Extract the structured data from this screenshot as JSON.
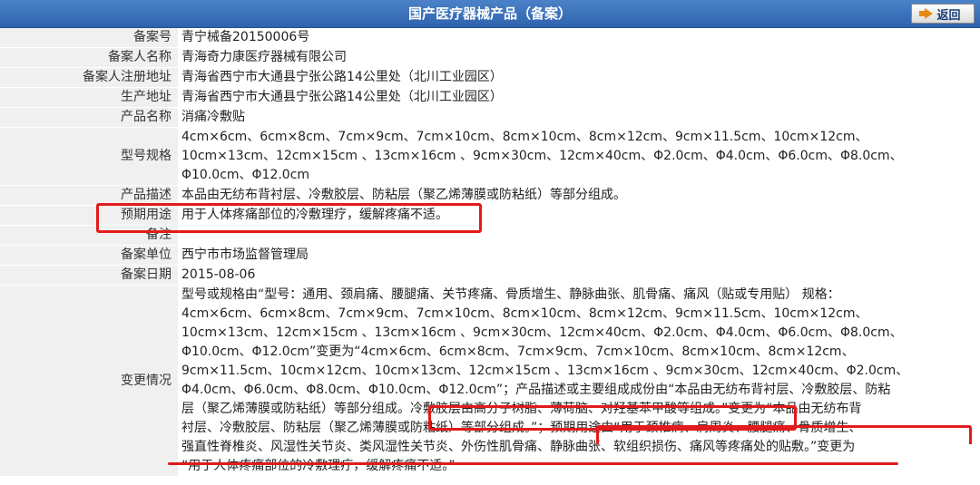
{
  "header": {
    "title": "国产医疗器械产品（备案）",
    "back_label": "返回"
  },
  "colors": {
    "header_bg": "#3a6fb8",
    "label_bg": "#f0f0f0",
    "highlight": "#e11b1b",
    "back_arrow": "#e58b12"
  },
  "rows": [
    {
      "label": "备案号",
      "value": "青宁械备20150006号"
    },
    {
      "label": "备案人名称",
      "value": "青海奇力康医疗器械有限公司"
    },
    {
      "label": "备案人注册地址",
      "value": "青海省西宁市大通县宁张公路14公里处（北川工业园区）"
    },
    {
      "label": "生产地址",
      "value": "青海省西宁市大通县宁张公路14公里处（北川工业园区）"
    },
    {
      "label": "产品名称",
      "value": "消痛冷敷贴"
    },
    {
      "label": "型号规格",
      "value": "4cm×6cm、6cm×8cm、7cm×9cm、7cm×10cm、8cm×10cm、8cm×12cm、9cm×11.5cm、10cm×12cm、\n10cm×13cm、12cm×15cm 、13cm×16cm 、9cm×30cm、12cm×40cm、Φ2.0cm、Φ4.0cm、Φ6.0cm、Φ8.0cm、\nΦ10.0cm、Φ12.0cm"
    },
    {
      "label": "产品描述",
      "value": "本品由无纺布背衬层、冷敷胶层、防粘层（聚乙烯薄膜或防粘纸）等部分组成。"
    },
    {
      "label": "预期用途",
      "value": "用于人体疼痛部位的冷敷理疗，缓解疼痛不适。"
    },
    {
      "label": "备注",
      "value": ""
    },
    {
      "label": "备案单位",
      "value": "西宁市市场监督管理局"
    },
    {
      "label": "备案日期",
      "value": "2015-08-06"
    },
    {
      "label": "变更情况",
      "value": "型号或规格由“型号：通用、颈肩痛、腰腿痛、关节疼痛、骨质增生、静脉曲张、肌骨痛、痛风（贴或专用贴） 规格：\n4cm×6cm、6cm×8cm、7cm×9cm、7cm×10cm、8cm×10cm、8cm×12cm、9cm×11.5cm、10cm×12cm、\n10cm×13cm、12cm×15cm 、13cm×16cm 、9cm×30cm、12cm×40cm、Φ2.0cm、Φ4.0cm、Φ6.0cm、Φ8.0cm、\nΦ10.0cm、Φ12.0cm”变更为“4cm×6cm、6cm×8cm、7cm×9cm、7cm×10cm、8cm×10cm、8cm×12cm、\n9cm×11.5cm、10cm×12cm、10cm×13cm、12cm×15cm 、13cm×16cm 、9cm×30cm、12cm×40cm、Φ2.0cm、\nΦ4.0cm、Φ6.0cm、Φ8.0cm、Φ10.0cm、Φ12.0cm”；产品描述或主要组成成份由“本品由无纺布背衬层、冷敷胶层、防粘\n层（聚乙烯薄膜或防粘纸）等部分组成。冷敷胶层由高分子树脂、薄荷脑、对羟基苯甲酸等组成。”变更为“本品由无纺布背\n衬层、冷敷胶层、防粘层（聚乙烯薄膜或防粘纸）等部分组成。”；预期用途由“用于颈椎病、肩周炎、腰腿痛、骨质增生、\n强直性脊椎炎、风湿性关节炎、类风湿性关节炎、外伤性肌骨痛、静脉曲张、软组织损伤、痛风等疼痛处的贴敷。”变更为\n“用于人体疼痛部位的冷敷理疗，缓解疼痛不适。”"
    }
  ]
}
